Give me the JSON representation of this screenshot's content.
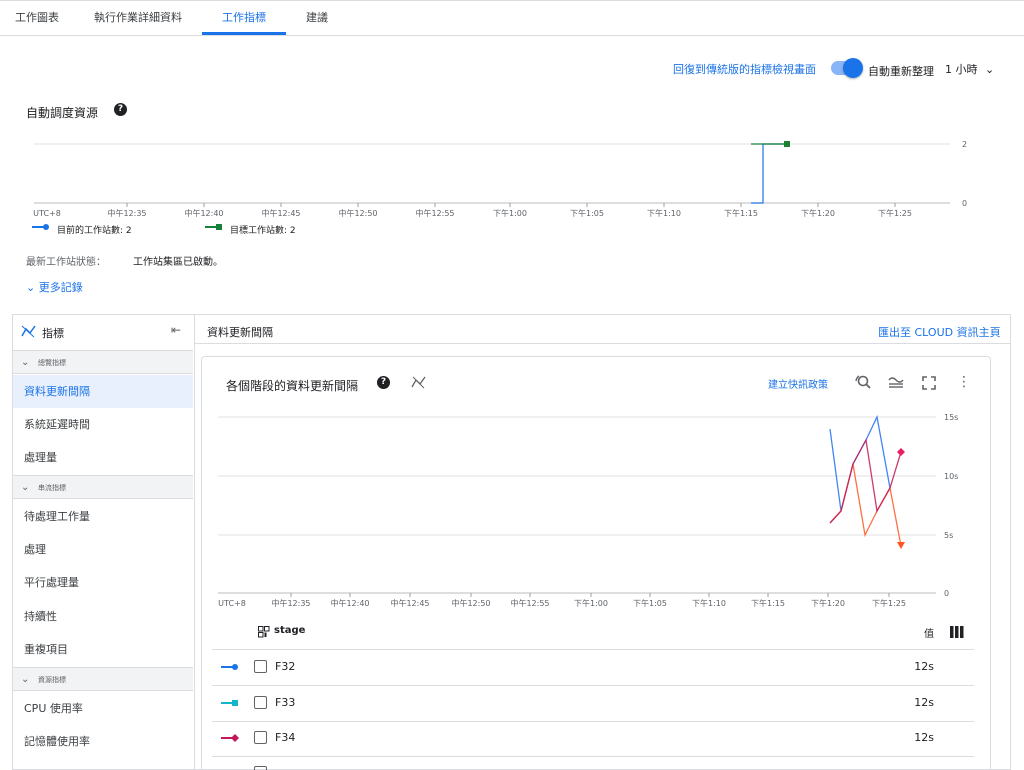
{
  "tabs": [
    {
      "label": "工作圖表"
    },
    {
      "label": "執行作業詳細資料"
    },
    {
      "label": "工作指標"
    },
    {
      "label": "建議"
    }
  ],
  "toolbar": {
    "legacy_link": "回復到傳統版的指標檢視畫面",
    "auto_refresh_label": "自動重新整理",
    "auto_refresh_on": true,
    "time_range": "1 小時"
  },
  "autoscaling": {
    "title": "自動調度資源",
    "y_ticks": [
      "2",
      "0"
    ],
    "x_ticks": [
      "UTC+8",
      "中午12:35",
      "中午12:40",
      "中午12:45",
      "中午12:50",
      "中午12:55",
      "下午1:00",
      "下午1:05",
      "下午1:10",
      "下午1:15",
      "下午1:20",
      "下午1:25"
    ],
    "legend_current": "目前的工作站數: 2",
    "legend_target": "目標工作站數: 2",
    "status_label": "最新工作站狀態：",
    "status_value": "工作站集區已啟動。",
    "more_logs": "更多記錄"
  },
  "sidebar": {
    "header": "指標",
    "groups": [
      {
        "label": "總覽指標",
        "items": [
          "資料更新間隔",
          "系統延遲時間",
          "處理量"
        ]
      },
      {
        "label": "串流指標",
        "items": [
          "待處理工作量",
          "處理",
          "平行處理量",
          "持續性",
          "重複項目"
        ]
      },
      {
        "label": "資源指標",
        "items": [
          "CPU 使用率",
          "記憶體使用率"
        ]
      }
    ]
  },
  "main": {
    "header": "資料更新間隔",
    "export_link": "匯出至 CLOUD 資訊主頁",
    "card_title": "各個階段的資料更新間隔",
    "create_alert": "建立快訊政策",
    "table": {
      "col_stage": "stage",
      "col_value": "值",
      "rows": [
        {
          "stage": "F32",
          "value": "12s"
        },
        {
          "stage": "F33",
          "value": "12s"
        },
        {
          "stage": "F34",
          "value": "12s"
        }
      ]
    }
  },
  "chart_data": [
    {
      "type": "line",
      "title": "自動調度資源",
      "x_ticks": [
        "中午12:35",
        "中午12:40",
        "中午12:45",
        "中午12:50",
        "中午12:55",
        "下午1:00",
        "下午1:05",
        "下午1:10",
        "下午1:15",
        "下午1:20",
        "下午1:25"
      ],
      "ylim": [
        0,
        2
      ],
      "series": [
        {
          "name": "目前的工作站數: 2",
          "color": "#1a73e8",
          "x": [
            "下午1:16",
            "下午1:16",
            "下午1:18"
          ],
          "values": [
            0,
            2,
            2
          ]
        },
        {
          "name": "目標工作站數: 2",
          "color": "#188038",
          "x": [
            "下午1:16",
            "下午1:18"
          ],
          "values": [
            2,
            2
          ]
        }
      ]
    },
    {
      "type": "line",
      "title": "各個階段的資料更新間隔",
      "x_ticks": [
        "中午12:35",
        "中午12:40",
        "中午12:45",
        "中午12:50",
        "中午12:55",
        "下午1:00",
        "下午1:05",
        "下午1:10",
        "下午1:15",
        "下午1:20",
        "下午1:25"
      ],
      "y_ticks": [
        "15s",
        "10s",
        "5s",
        "0"
      ],
      "ylim": [
        0,
        15
      ],
      "series": [
        {
          "name": "F32",
          "color": "#4285f4",
          "x": [
            "下午1:20",
            "下午1:21",
            "下午1:22",
            "下午1:23",
            "下午1:24",
            "下午1:25"
          ],
          "values": [
            14,
            7,
            11,
            13,
            15,
            9
          ]
        },
        {
          "name": "F33",
          "color": "#ff7043",
          "x": [
            "下午1:20",
            "下午1:21",
            "下午1:22",
            "下午1:23",
            "下午1:24",
            "下午1:25",
            "下午1:26"
          ],
          "values": [
            6,
            7,
            11,
            5,
            7,
            9,
            4
          ]
        },
        {
          "name": "F34",
          "color": "#c2185b",
          "x": [
            "下午1:20",
            "下午1:21",
            "下午1:22",
            "下午1:23",
            "下午1:24",
            "下午1:25",
            "下午1:26"
          ],
          "values": [
            6,
            7,
            11,
            13,
            7,
            9,
            12
          ]
        }
      ]
    }
  ]
}
